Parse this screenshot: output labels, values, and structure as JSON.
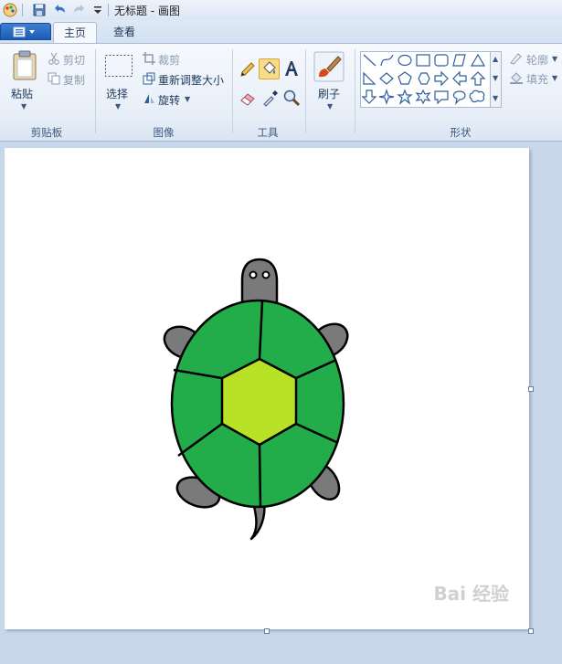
{
  "window": {
    "title": "无标题 - 画图"
  },
  "tabs": [
    {
      "label": "主页"
    },
    {
      "label": "查看"
    }
  ],
  "clipboard": {
    "paste": "粘贴",
    "cut": "剪切",
    "copy": "复制",
    "group": "剪贴板"
  },
  "image": {
    "select": "选择",
    "crop": "裁剪",
    "resize": "重新调整大小",
    "rotate": "旋转",
    "group": "图像"
  },
  "tools": {
    "group": "工具"
  },
  "brush": {
    "label": "刷子"
  },
  "shapes": {
    "outline": "轮廓",
    "fill": "填充",
    "group": "形状"
  },
  "drawing": {
    "shell_color": "#22ad4a",
    "center_color": "#b8e225",
    "limb_color": "#7a7a7a",
    "outline_color": "#000000"
  },
  "watermark": "Bai 经验"
}
